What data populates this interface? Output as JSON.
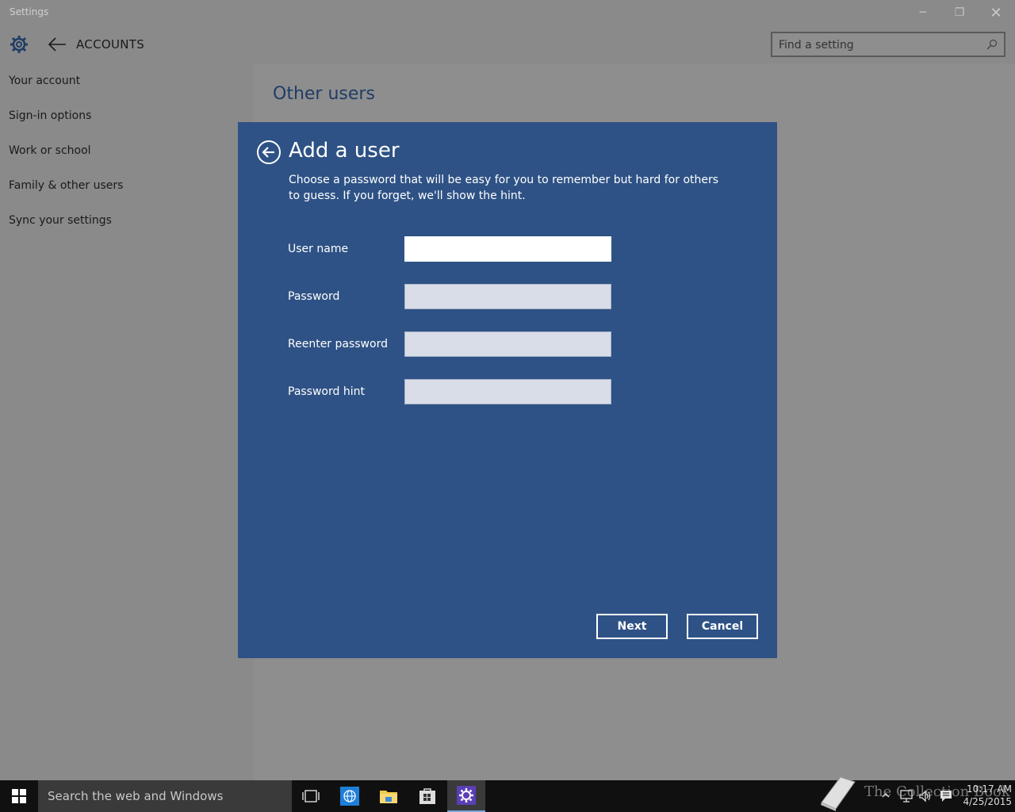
{
  "window": {
    "title": "Settings",
    "minimize_glyph": "─",
    "maximize_glyph": "❐",
    "close_glyph": "✕"
  },
  "header": {
    "section": "ACCOUNTS",
    "search_placeholder": "Find a setting"
  },
  "nav": {
    "items": [
      {
        "label": "Your account"
      },
      {
        "label": "Sign-in options"
      },
      {
        "label": "Work or school"
      },
      {
        "label": "Family & other users"
      },
      {
        "label": "Sync your settings"
      }
    ]
  },
  "main": {
    "heading": "Other users"
  },
  "dialog": {
    "title": "Add a user",
    "description": "Choose a password that will be easy for you to remember but hard for others to guess. If you forget, we'll show the hint.",
    "fields": [
      {
        "label": "User name",
        "value": ""
      },
      {
        "label": "Password",
        "value": ""
      },
      {
        "label": "Reenter password",
        "value": ""
      },
      {
        "label": "Password hint",
        "value": ""
      }
    ],
    "next_label": "Next",
    "cancel_label": "Cancel"
  },
  "taskbar": {
    "search_text": "Search the web and Windows",
    "time": "10:17 AM",
    "date": "4/25/2015",
    "watermark": "The Collection Book"
  },
  "colors": {
    "dialog_bg": "#2e5285",
    "heading": "#1f3d66",
    "taskbar_accent": "#7aa7e0"
  }
}
